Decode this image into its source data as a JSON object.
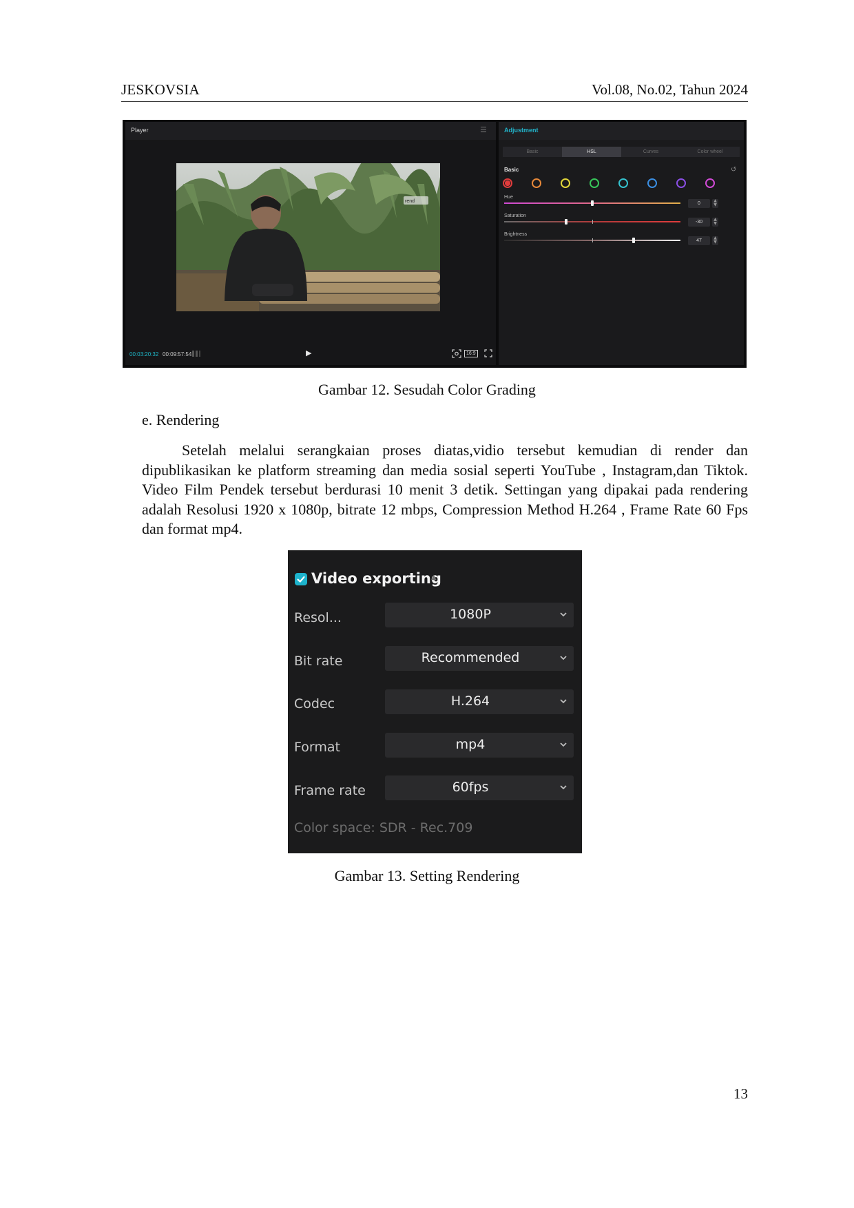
{
  "header": {
    "journal": "JESKOVSIA",
    "volume": "Vol.08, No.02, Tahun 2024"
  },
  "figure12": {
    "player": {
      "title": "Player",
      "time_current": "00:03:20:32",
      "time_total": "00:09:57:54",
      "ratio": "16:9",
      "frame_text": "rend"
    },
    "adjustment": {
      "title": "Adjustment",
      "tabs": [
        "Basic",
        "HSL",
        "Curves",
        "Color wheel"
      ],
      "active_tab": "HSL",
      "section": "Basic",
      "swatch_colors": [
        "#e03c3c",
        "#e8893a",
        "#e3d83a",
        "#38c75a",
        "#35c3cf",
        "#3b8fe3",
        "#8b4fe6",
        "#d14ad6"
      ],
      "params": [
        {
          "label": "Hue",
          "value": "0",
          "level": 0.5
        },
        {
          "label": "Saturation",
          "value": "-30",
          "level": 0.35
        },
        {
          "label": "Brightness",
          "value": "47",
          "level": 0.735
        }
      ]
    },
    "caption": "Gambar 12. Sesudah Color Grading"
  },
  "section_heading": "e. Rendering",
  "paragraph": "Setelah melalui serangkaian proses diatas,vidio tersebut kemudian di render dan dipublikasikan ke platform streaming dan media sosial seperti YouTube , Instagram,dan Tiktok.  Video Film Pendek tersebut berdurasi 10 menit 3 detik. Settingan yang dipakai pada rendering adalah Resolusi 1920 x 1080p, bitrate 12 mbps, Compression Method H.264 , Frame Rate 60 Fps dan format mp4.",
  "figure13": {
    "title": "Video exporting",
    "rows": [
      {
        "label": "Resol...",
        "value": "1080P"
      },
      {
        "label": "Bit rate",
        "value": "Recommended"
      },
      {
        "label": "Codec",
        "value": "H.264"
      },
      {
        "label": "Format",
        "value": "mp4"
      },
      {
        "label": "Frame rate",
        "value": "60fps"
      }
    ],
    "color_space": "Color space: SDR - Rec.709",
    "caption": "Gambar 13. Setting Rendering"
  },
  "page_number": "13"
}
